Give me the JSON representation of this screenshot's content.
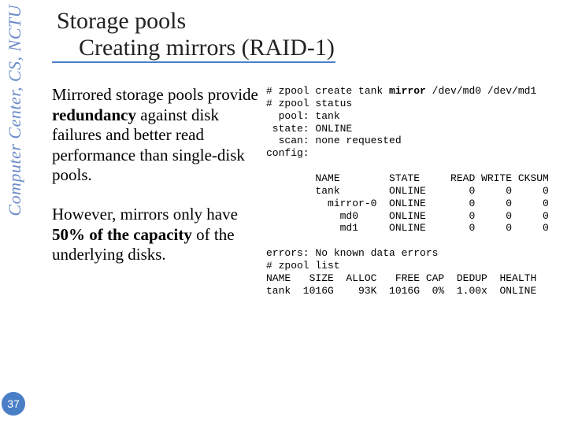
{
  "sidebar": {
    "label": "Computer Center, CS, NCTU"
  },
  "page_number": "37",
  "title": {
    "line1": "Storage pools",
    "line2": "Creating mirrors (RAID-1)"
  },
  "body": {
    "p1_a": "Mirrored storage pools provide ",
    "p1_bold": "redundancy",
    "p1_b": " against disk failures and better read performance than single-disk pools.",
    "p2_a": "However, mirrors only have ",
    "p2_bold": "50% of the capacity",
    "p2_b": " of the underlying disks."
  },
  "terminal": {
    "l1a": "# zpool create tank ",
    "l1b": "mirror",
    "l1c": " /dev/md0 /dev/md1",
    "l2": "# zpool status",
    "l3": "  pool: tank",
    "l4": " state: ONLINE",
    "l5": "  scan: none requested",
    "l6": "config:",
    "l7": "",
    "l8": "        NAME        STATE     READ WRITE CKSUM",
    "l9": "        tank        ONLINE       0     0     0",
    "l10": "          mirror-0  ONLINE       0     0     0",
    "l11": "            md0     ONLINE       0     0     0",
    "l12": "            md1     ONLINE       0     0     0",
    "l13": "",
    "l14": "errors: No known data errors",
    "l15": "# zpool list",
    "l16": "NAME   SIZE  ALLOC   FREE CAP  DEDUP  HEALTH",
    "l17": "tank  1016G    93K  1016G  0%  1.00x  ONLINE"
  },
  "chart_data": {
    "type": "table",
    "title": "zpool list",
    "columns": [
      "NAME",
      "SIZE",
      "ALLOC",
      "FREE",
      "CAP",
      "DEDUP",
      "HEALTH"
    ],
    "rows": [
      [
        "tank",
        "1016G",
        "93K",
        "1016G",
        "0%",
        "1.00x",
        "ONLINE"
      ]
    ]
  }
}
